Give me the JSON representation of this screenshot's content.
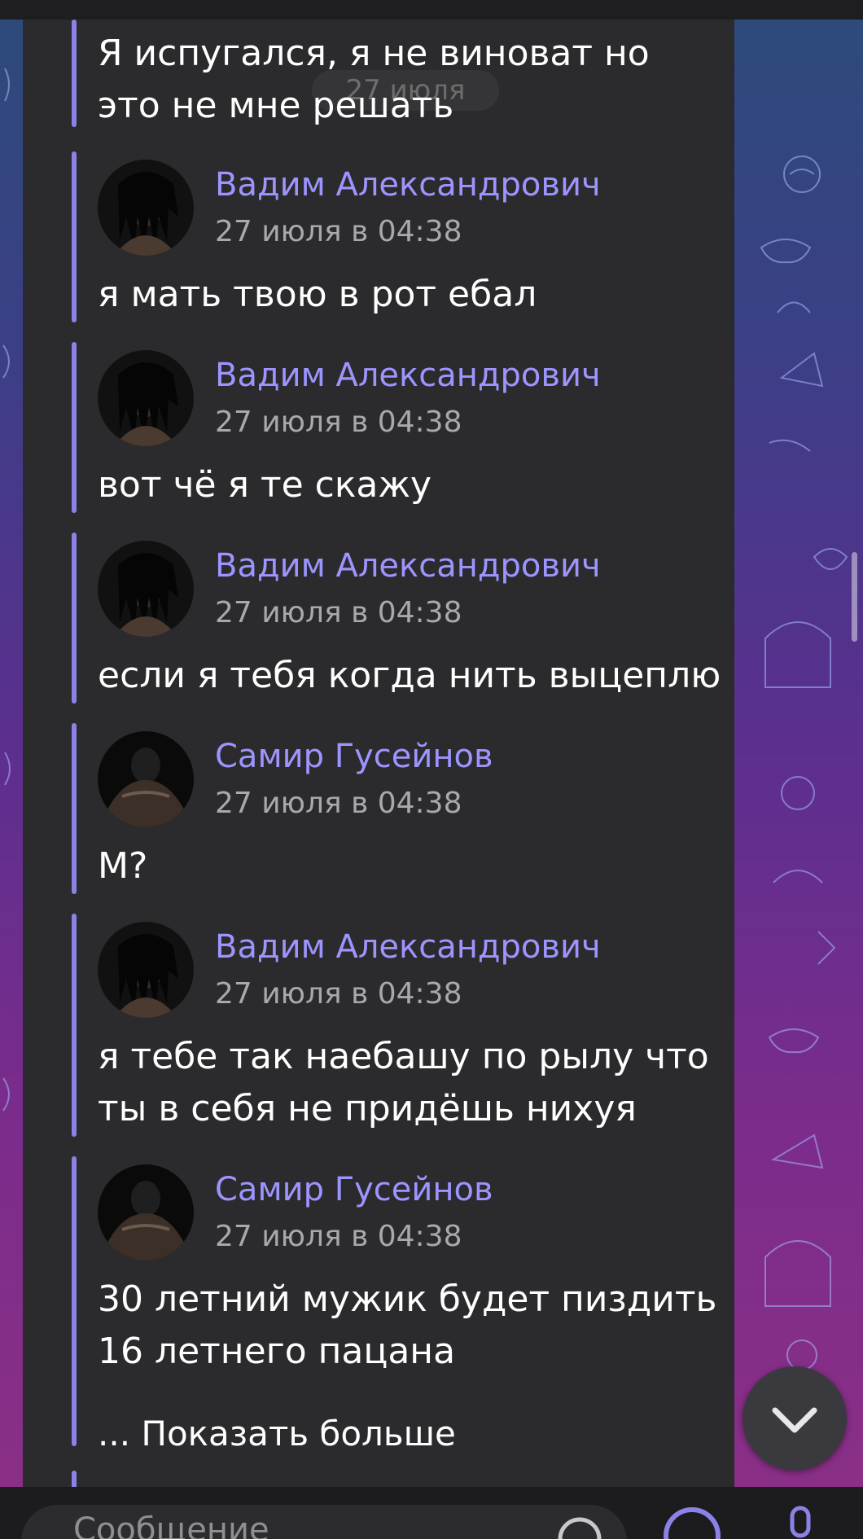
{
  "date_header": "27 июля",
  "messages": [
    {
      "text": "Я испугался, я не виноват но\nэто не мне решать"
    },
    {
      "author": "Вадим Александрович",
      "time": "27 июля в 04:38",
      "text": "я мать твою в рот ебал"
    },
    {
      "author": "Вадим Александрович",
      "time": "27 июля в 04:38",
      "text": "вот чё я те скажу"
    },
    {
      "author": "Вадим Александрович",
      "time": "27 июля в 04:38",
      "text": "если я тебя когда нить выцеплю"
    },
    {
      "author": "Самир Гусейнов",
      "time": "27 июля в 04:38",
      "text": "М?"
    },
    {
      "author": "Вадим Александрович",
      "time": "27 июля в 04:38",
      "text": "я тебе так наебашу по рылу что\nты в себя не придёшь нихуя"
    },
    {
      "author": "Самир Гусейнов",
      "time": "27 июля в 04:38",
      "text": "30 летний мужик будет пиздить\n16 летнего пацана",
      "show_more": "... Показать больше"
    }
  ],
  "composer": {
    "placeholder": "Сообщение"
  },
  "icons": {
    "scroll_down": "chevron-down-icon",
    "emoji": "emoji-icon",
    "mic": "mic-icon",
    "sticker": "sticker-icon"
  },
  "colors": {
    "accent": "#8b82e8",
    "author": "#9d95ff",
    "panel": "#2b2b2d"
  }
}
